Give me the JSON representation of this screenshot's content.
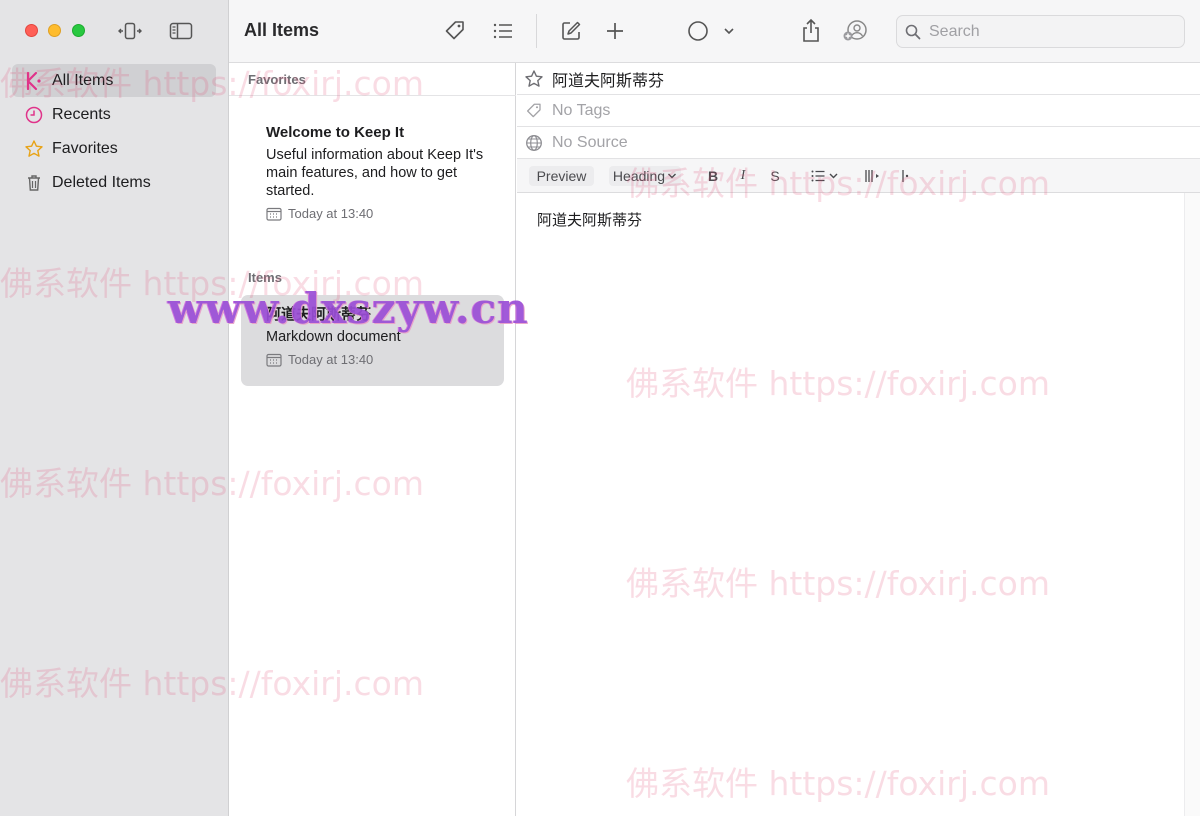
{
  "sidebar": {
    "items": [
      {
        "label": "All Items",
        "icon": "keep-it-icon",
        "active": true
      },
      {
        "label": "Recents",
        "icon": "clock-icon",
        "active": false
      },
      {
        "label": "Favorites",
        "icon": "star-icon",
        "active": false
      },
      {
        "label": "Deleted Items",
        "icon": "trash-icon",
        "active": false
      }
    ]
  },
  "toolbar": {
    "title": "All Items",
    "search_placeholder": "Search"
  },
  "list": {
    "favorites_header": "Favorites",
    "items_header": "Items",
    "favorites": [
      {
        "title": "Welcome to Keep It",
        "description": "Useful information about Keep It's main features, and how to get started.",
        "date": "Today at 13:40"
      }
    ],
    "items": [
      {
        "title": "阿道夫阿斯蒂芬",
        "description": "Markdown document",
        "date": "Today at 13:40"
      }
    ]
  },
  "editor": {
    "title": "阿道夫阿斯蒂芬",
    "tags_placeholder": "No Tags",
    "source_placeholder": "No Source",
    "format_bar": {
      "preview": "Preview",
      "heading": "Heading",
      "bold": "B",
      "italic": "I",
      "strike": "S"
    },
    "body": "阿道夫阿斯蒂芬"
  },
  "watermarks": {
    "foxirj": "佛系软件 https://foxirj.com",
    "dxszyw": "www.dxszyw.cn"
  },
  "colors": {
    "accent": "#e0338a",
    "sidebar_bg": "#e4e4e6",
    "selected_bg": "#dcdcde"
  }
}
